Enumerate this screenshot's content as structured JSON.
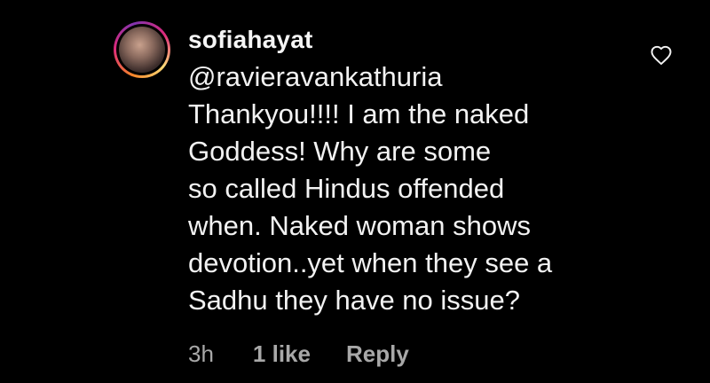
{
  "comment": {
    "username": "sofiahayat",
    "text_lines": [
      "@ravieravankathuria",
      "Thankyou!!!! I am the naked",
      "Goddess! Why are some",
      "so called Hindus offended",
      "when. Naked woman shows",
      "devotion..yet when they see a",
      "Sadhu they have no issue?"
    ],
    "time": "3h",
    "likes": "1 like",
    "reply_label": "Reply",
    "like_icon": "heart-outline-icon"
  },
  "colors": {
    "background": "#000000",
    "text": "#f2f2f2",
    "meta_text": "#a8a8a8",
    "avatar_ring": "#dd2a7b"
  }
}
